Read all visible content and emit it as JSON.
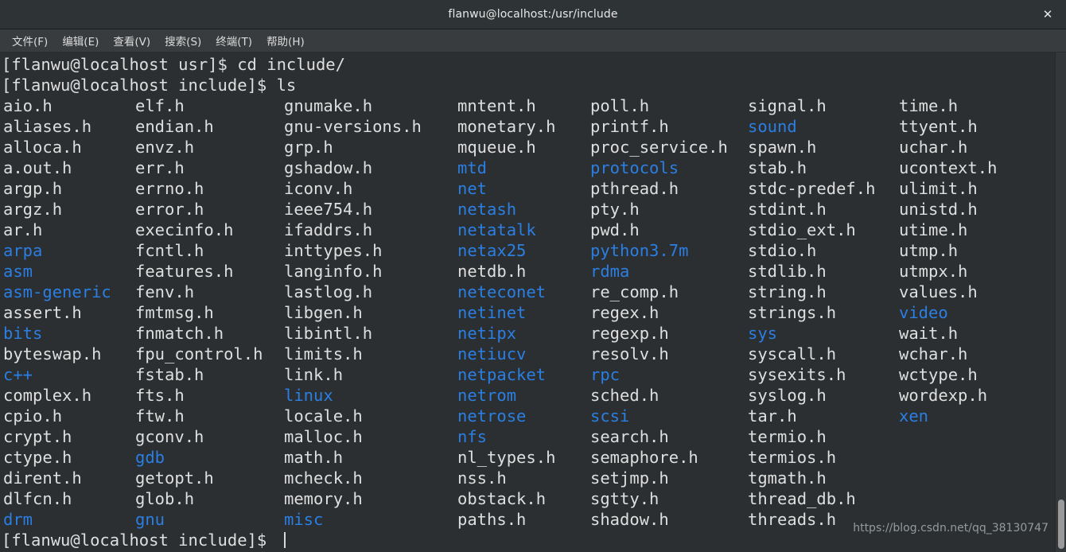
{
  "window": {
    "title": "flanwu@localhost:/usr/include",
    "close_label": "✕"
  },
  "menubar": {
    "items": [
      {
        "label": "文件(F)",
        "name": "menu-file"
      },
      {
        "label": "编辑(E)",
        "name": "menu-edit"
      },
      {
        "label": "查看(V)",
        "name": "menu-view"
      },
      {
        "label": "搜索(S)",
        "name": "menu-search"
      },
      {
        "label": "终端(T)",
        "name": "menu-terminal"
      },
      {
        "label": "帮助(H)",
        "name": "menu-help"
      }
    ]
  },
  "colors": {
    "background": "#2b2f31",
    "foreground": "#dfdfdf",
    "directory_blue": "#2b7fe3",
    "titlebar": "#2e3335",
    "menubar": "#383c3e"
  },
  "terminal": {
    "lines": [
      {
        "text": "[flanwu@localhost usr]$ cd include/"
      },
      {
        "text": "[flanwu@localhost include]$ ls"
      }
    ],
    "final_prompt": "[flanwu@localhost include]$ ",
    "cursor_visible": true,
    "column_x": [
      2,
      168,
      355,
      573,
      740,
      938,
      1128
    ],
    "listing_columns": [
      [
        {
          "name": "aio.h",
          "type": "file"
        },
        {
          "name": "aliases.h",
          "type": "file"
        },
        {
          "name": "alloca.h",
          "type": "file"
        },
        {
          "name": "a.out.h",
          "type": "file"
        },
        {
          "name": "argp.h",
          "type": "file"
        },
        {
          "name": "argz.h",
          "type": "file"
        },
        {
          "name": "ar.h",
          "type": "file"
        },
        {
          "name": "arpa",
          "type": "dir"
        },
        {
          "name": "asm",
          "type": "dir"
        },
        {
          "name": "asm-generic",
          "type": "dir"
        },
        {
          "name": "assert.h",
          "type": "file"
        },
        {
          "name": "bits",
          "type": "dir"
        },
        {
          "name": "byteswap.h",
          "type": "file"
        },
        {
          "name": "c++",
          "type": "dir"
        },
        {
          "name": "complex.h",
          "type": "file"
        },
        {
          "name": "cpio.h",
          "type": "file"
        },
        {
          "name": "crypt.h",
          "type": "file"
        },
        {
          "name": "ctype.h",
          "type": "file"
        },
        {
          "name": "dirent.h",
          "type": "file"
        },
        {
          "name": "dlfcn.h",
          "type": "file"
        },
        {
          "name": "drm",
          "type": "dir"
        }
      ],
      [
        {
          "name": "elf.h",
          "type": "file"
        },
        {
          "name": "endian.h",
          "type": "file"
        },
        {
          "name": "envz.h",
          "type": "file"
        },
        {
          "name": "err.h",
          "type": "file"
        },
        {
          "name": "errno.h",
          "type": "file"
        },
        {
          "name": "error.h",
          "type": "file"
        },
        {
          "name": "execinfo.h",
          "type": "file"
        },
        {
          "name": "fcntl.h",
          "type": "file"
        },
        {
          "name": "features.h",
          "type": "file"
        },
        {
          "name": "fenv.h",
          "type": "file"
        },
        {
          "name": "fmtmsg.h",
          "type": "file"
        },
        {
          "name": "fnmatch.h",
          "type": "file"
        },
        {
          "name": "fpu_control.h",
          "type": "file"
        },
        {
          "name": "fstab.h",
          "type": "file"
        },
        {
          "name": "fts.h",
          "type": "file"
        },
        {
          "name": "ftw.h",
          "type": "file"
        },
        {
          "name": "gconv.h",
          "type": "file"
        },
        {
          "name": "gdb",
          "type": "dir"
        },
        {
          "name": "getopt.h",
          "type": "file"
        },
        {
          "name": "glob.h",
          "type": "file"
        },
        {
          "name": "gnu",
          "type": "dir"
        }
      ],
      [
        {
          "name": "gnumake.h",
          "type": "file"
        },
        {
          "name": "gnu-versions.h",
          "type": "file"
        },
        {
          "name": "grp.h",
          "type": "file"
        },
        {
          "name": "gshadow.h",
          "type": "file"
        },
        {
          "name": "iconv.h",
          "type": "file"
        },
        {
          "name": "ieee754.h",
          "type": "file"
        },
        {
          "name": "ifaddrs.h",
          "type": "file"
        },
        {
          "name": "inttypes.h",
          "type": "file"
        },
        {
          "name": "langinfo.h",
          "type": "file"
        },
        {
          "name": "lastlog.h",
          "type": "file"
        },
        {
          "name": "libgen.h",
          "type": "file"
        },
        {
          "name": "libintl.h",
          "type": "file"
        },
        {
          "name": "limits.h",
          "type": "file"
        },
        {
          "name": "link.h",
          "type": "file"
        },
        {
          "name": "linux",
          "type": "dir"
        },
        {
          "name": "locale.h",
          "type": "file"
        },
        {
          "name": "malloc.h",
          "type": "file"
        },
        {
          "name": "math.h",
          "type": "file"
        },
        {
          "name": "mcheck.h",
          "type": "file"
        },
        {
          "name": "memory.h",
          "type": "file"
        },
        {
          "name": "misc",
          "type": "dir"
        }
      ],
      [
        {
          "name": "mntent.h",
          "type": "file"
        },
        {
          "name": "monetary.h",
          "type": "file"
        },
        {
          "name": "mqueue.h",
          "type": "file"
        },
        {
          "name": "mtd",
          "type": "dir"
        },
        {
          "name": "net",
          "type": "dir"
        },
        {
          "name": "netash",
          "type": "dir"
        },
        {
          "name": "netatalk",
          "type": "dir"
        },
        {
          "name": "netax25",
          "type": "dir"
        },
        {
          "name": "netdb.h",
          "type": "file"
        },
        {
          "name": "neteconet",
          "type": "dir"
        },
        {
          "name": "netinet",
          "type": "dir"
        },
        {
          "name": "netipx",
          "type": "dir"
        },
        {
          "name": "netiucv",
          "type": "dir"
        },
        {
          "name": "netpacket",
          "type": "dir"
        },
        {
          "name": "netrom",
          "type": "dir"
        },
        {
          "name": "netrose",
          "type": "dir"
        },
        {
          "name": "nfs",
          "type": "dir"
        },
        {
          "name": "nl_types.h",
          "type": "file"
        },
        {
          "name": "nss.h",
          "type": "file"
        },
        {
          "name": "obstack.h",
          "type": "file"
        },
        {
          "name": "paths.h",
          "type": "file"
        }
      ],
      [
        {
          "name": "poll.h",
          "type": "file"
        },
        {
          "name": "printf.h",
          "type": "file"
        },
        {
          "name": "proc_service.h",
          "type": "file"
        },
        {
          "name": "protocols",
          "type": "dir"
        },
        {
          "name": "pthread.h",
          "type": "file"
        },
        {
          "name": "pty.h",
          "type": "file"
        },
        {
          "name": "pwd.h",
          "type": "file"
        },
        {
          "name": "python3.7m",
          "type": "dir"
        },
        {
          "name": "rdma",
          "type": "dir"
        },
        {
          "name": "re_comp.h",
          "type": "file"
        },
        {
          "name": "regex.h",
          "type": "file"
        },
        {
          "name": "regexp.h",
          "type": "file"
        },
        {
          "name": "resolv.h",
          "type": "file"
        },
        {
          "name": "rpc",
          "type": "dir"
        },
        {
          "name": "sched.h",
          "type": "file"
        },
        {
          "name": "scsi",
          "type": "dir"
        },
        {
          "name": "search.h",
          "type": "file"
        },
        {
          "name": "semaphore.h",
          "type": "file"
        },
        {
          "name": "setjmp.h",
          "type": "file"
        },
        {
          "name": "sgtty.h",
          "type": "file"
        },
        {
          "name": "shadow.h",
          "type": "file"
        }
      ],
      [
        {
          "name": "signal.h",
          "type": "file"
        },
        {
          "name": "sound",
          "type": "dir"
        },
        {
          "name": "spawn.h",
          "type": "file"
        },
        {
          "name": "stab.h",
          "type": "file"
        },
        {
          "name": "stdc-predef.h",
          "type": "file"
        },
        {
          "name": "stdint.h",
          "type": "file"
        },
        {
          "name": "stdio_ext.h",
          "type": "file"
        },
        {
          "name": "stdio.h",
          "type": "file"
        },
        {
          "name": "stdlib.h",
          "type": "file"
        },
        {
          "name": "string.h",
          "type": "file"
        },
        {
          "name": "strings.h",
          "type": "file"
        },
        {
          "name": "sys",
          "type": "dir"
        },
        {
          "name": "syscall.h",
          "type": "file"
        },
        {
          "name": "sysexits.h",
          "type": "file"
        },
        {
          "name": "syslog.h",
          "type": "file"
        },
        {
          "name": "tar.h",
          "type": "file"
        },
        {
          "name": "termio.h",
          "type": "file"
        },
        {
          "name": "termios.h",
          "type": "file"
        },
        {
          "name": "tgmath.h",
          "type": "file"
        },
        {
          "name": "thread_db.h",
          "type": "file"
        },
        {
          "name": "threads.h",
          "type": "file"
        }
      ],
      [
        {
          "name": "time.h",
          "type": "file"
        },
        {
          "name": "ttyent.h",
          "type": "file"
        },
        {
          "name": "uchar.h",
          "type": "file"
        },
        {
          "name": "ucontext.h",
          "type": "file"
        },
        {
          "name": "ulimit.h",
          "type": "file"
        },
        {
          "name": "unistd.h",
          "type": "file"
        },
        {
          "name": "utime.h",
          "type": "file"
        },
        {
          "name": "utmp.h",
          "type": "file"
        },
        {
          "name": "utmpx.h",
          "type": "file"
        },
        {
          "name": "values.h",
          "type": "file"
        },
        {
          "name": "video",
          "type": "dir"
        },
        {
          "name": "wait.h",
          "type": "file"
        },
        {
          "name": "wchar.h",
          "type": "file"
        },
        {
          "name": "wctype.h",
          "type": "file"
        },
        {
          "name": "wordexp.h",
          "type": "file"
        },
        {
          "name": "xen",
          "type": "dir"
        }
      ]
    ]
  },
  "watermark": {
    "text": "https://blog.csdn.net/qq_38130747"
  }
}
